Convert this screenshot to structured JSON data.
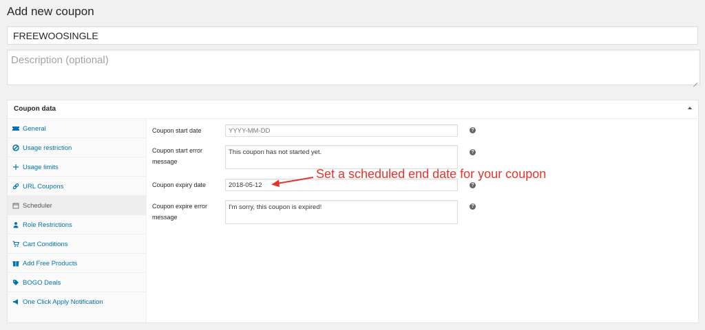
{
  "page": {
    "title": "Add new coupon"
  },
  "coupon": {
    "code": "FREEWOOSINGLE",
    "description_placeholder": "Description (optional)"
  },
  "panel": {
    "title": "Coupon data",
    "tabs": [
      {
        "label": "General",
        "icon": "ticket-icon",
        "active": false
      },
      {
        "label": "Usage restriction",
        "icon": "block-icon",
        "active": false
      },
      {
        "label": "Usage limits",
        "icon": "plus-icon",
        "active": false
      },
      {
        "label": "URL Coupons",
        "icon": "link-icon",
        "active": false
      },
      {
        "label": "Scheduler",
        "icon": "calendar-icon",
        "active": true
      },
      {
        "label": "Role Restrictions",
        "icon": "person-icon",
        "active": false
      },
      {
        "label": "Cart Conditions",
        "icon": "cart-icon",
        "active": false
      },
      {
        "label": "Add Free Products",
        "icon": "gift-icon",
        "active": false
      },
      {
        "label": "BOGO Deals",
        "icon": "tags-icon",
        "active": false
      },
      {
        "label": "One Click Apply Notification",
        "icon": "megaphone-icon",
        "active": false
      }
    ],
    "fields": {
      "start_date": {
        "label": "Coupon start date",
        "placeholder": "YYYY-MM-DD"
      },
      "start_error": {
        "label": "Coupon start error message",
        "value": "This coupon has not started yet."
      },
      "expiry_date": {
        "label": "Coupon expiry date",
        "value": "2018-05-12"
      },
      "expire_error": {
        "label": "Coupon expire error message",
        "value": "I'm sorry, this coupon is expired!"
      }
    }
  },
  "annotation": {
    "text": "Set a scheduled end date for your coupon",
    "color": "#e8332a"
  },
  "colors": {
    "link": "#0073aa",
    "background": "#f1f1f1"
  }
}
